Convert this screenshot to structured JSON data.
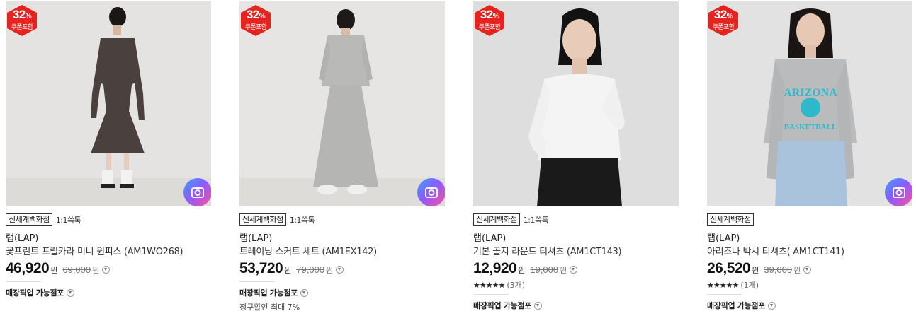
{
  "products": [
    {
      "badge_percent": "32",
      "badge_percent_symbol": "%",
      "badge_label": "쿠폰포함",
      "store_tag": "신세계백화점",
      "talk_tag": "1:1쓱톡",
      "brand": "랩(LAP)",
      "name": "꽃프린트 프릴카라 미니 원피스 (AM1WO268)",
      "price": "46,920",
      "currency": "원",
      "original_price": "69,000",
      "pickup_label": "매장픽업 가능점포"
    },
    {
      "badge_percent": "32",
      "badge_percent_symbol": "%",
      "badge_label": "쿠폰포함",
      "store_tag": "신세계백화점",
      "talk_tag": "1:1쓱톡",
      "brand": "랩(LAP)",
      "name": "트레이닝 스커트 세트 (AM1EX142)",
      "price": "53,720",
      "currency": "원",
      "original_price": "79,000",
      "pickup_label": "매장픽업 가능점포",
      "bill_discount": "청구할인 최대 7%"
    },
    {
      "badge_percent": "32",
      "badge_percent_symbol": "%",
      "badge_label": "쿠폰포함",
      "store_tag": "신세계백화점",
      "talk_tag": "1:1쓱톡",
      "brand": "랩(LAP)",
      "name": "기본 골지 라운드 티셔츠 (AM1CT143)",
      "price": "12,920",
      "currency": "원",
      "original_price": "19,000",
      "rating_stars": "★★★★★",
      "review_count": "(3개)",
      "pickup_label": "매장픽업 가능점포"
    },
    {
      "badge_percent": "32",
      "badge_percent_symbol": "%",
      "badge_label": "쿠폰포함",
      "store_tag": "신세계백화점",
      "brand": "랩(LAP)",
      "name": "아리조나 박시 티셔츠( AM1CT141)",
      "price": "26,520",
      "currency": "원",
      "original_price": "39,000",
      "rating_stars": "★★★★★",
      "review_count": "(1개)",
      "pickup_label": "매장픽업 가능점포",
      "sweatshirt_print_top": "ARIZONA",
      "sweatshirt_print_bottom": "BASKETBALL"
    }
  ],
  "colors": {
    "badge_red": "#e5241f",
    "text_primary": "#222222",
    "text_muted": "#777777",
    "camera_gradient": [
      "#3aa0ff",
      "#8a5cff",
      "#ff4f9a"
    ],
    "print_teal": "#2fb8c9"
  },
  "icons": {
    "badge": "discount-hexagon-icon",
    "camera": "camera-icon",
    "info": "chevron-down-circle-icon",
    "star": "star-icon"
  }
}
